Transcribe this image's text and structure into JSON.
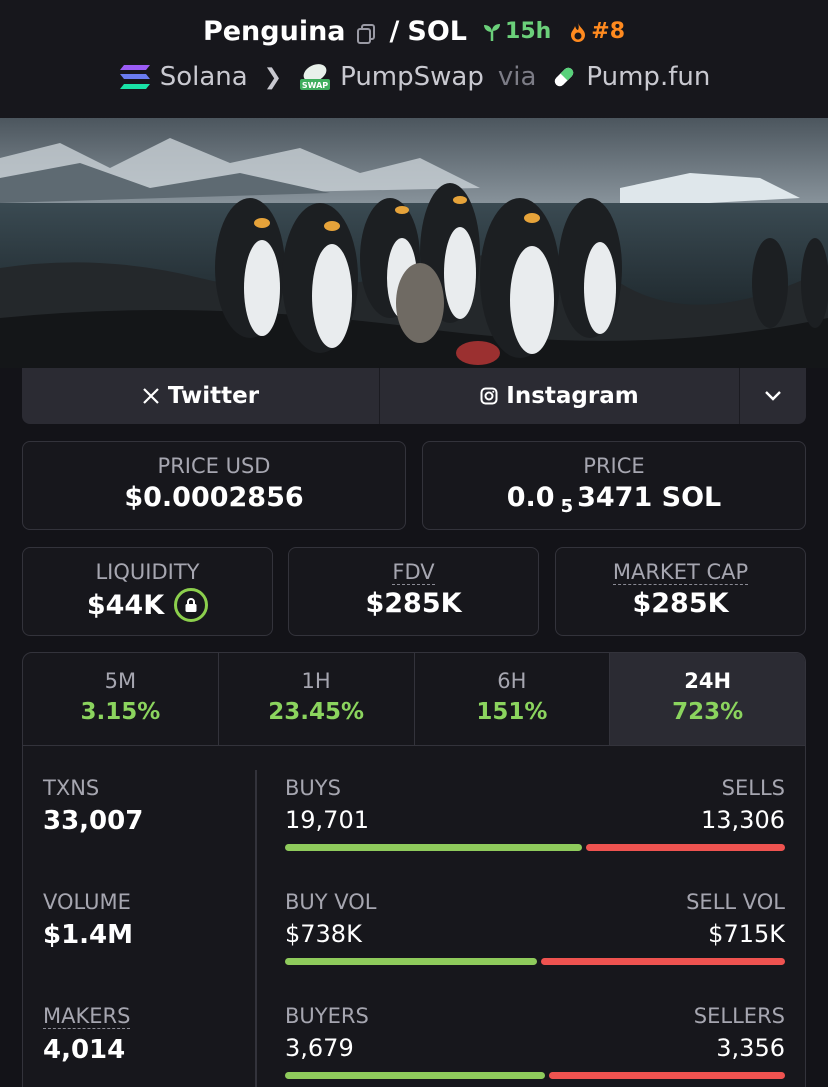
{
  "header": {
    "token_name": "Penguina",
    "pair_sep": "/",
    "quote": "SOL",
    "age": "15h",
    "rank": "#8",
    "chain": "Solana",
    "dex": "PumpSwap",
    "via": "via",
    "launchpad": "Pump.fun",
    "colors": {
      "age": "#6bd07a",
      "rank": "#ff8a1f"
    }
  },
  "social": {
    "twitter": "Twitter",
    "instagram": "Instagram"
  },
  "price": {
    "usd_label": "PRICE USD",
    "usd_value": "$0.0002856",
    "native_label": "PRICE",
    "native_prefix": "0.0",
    "native_subscript": "5",
    "native_rest": "3471 SOL"
  },
  "stats": {
    "liquidity_label": "LIQUIDITY",
    "liquidity_value": "$44K",
    "fdv_label": "FDV",
    "fdv_value": "$285K",
    "mcap_label": "MARKET CAP",
    "mcap_value": "$285K"
  },
  "periods": [
    {
      "label": "5M",
      "value": "3.15%"
    },
    {
      "label": "1H",
      "value": "23.45%"
    },
    {
      "label": "6H",
      "value": "151%"
    },
    {
      "label": "24H",
      "value": "723%"
    }
  ],
  "activity": {
    "txns_label": "TXNS",
    "txns_value": "33,007",
    "volume_label": "VOLUME",
    "volume_value": "$1.4M",
    "makers_label": "MAKERS",
    "makers_value": "4,014",
    "buys_label": "BUYS",
    "buys_value": "19,701",
    "sells_label": "SELLS",
    "sells_value": "13,306",
    "buy_vol_label": "BUY VOL",
    "buy_vol_value": "$738K",
    "sell_vol_label": "SELL VOL",
    "sell_vol_value": "$715K",
    "buyers_label": "BUYERS",
    "buyers_value": "3,679",
    "sellers_label": "SELLERS",
    "sellers_value": "3,356",
    "buy_share": [
      0.597,
      0.508,
      0.523
    ]
  },
  "colors": {
    "positive": "#8bd45e",
    "buy": "#8fcb5c",
    "sell": "#ef5350"
  }
}
